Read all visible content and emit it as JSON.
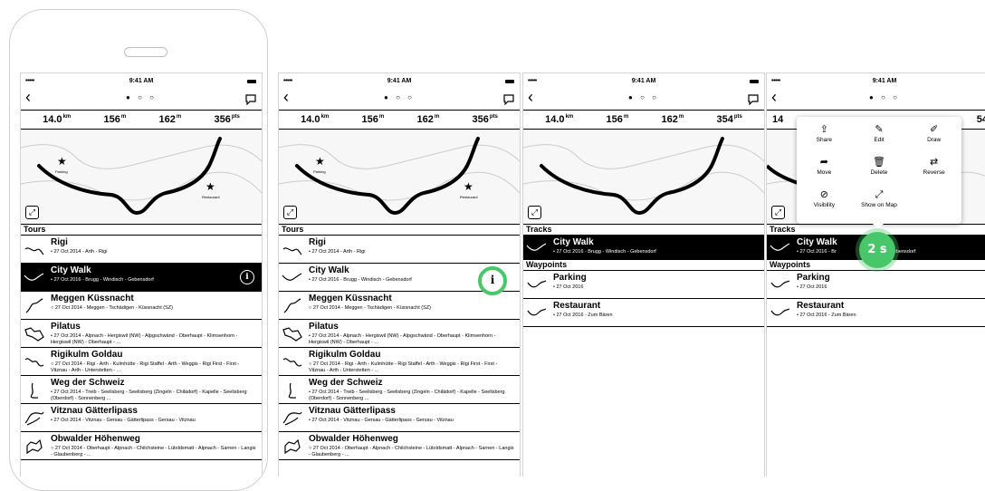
{
  "status": {
    "signal": "•••••",
    "time": "9:41 AM"
  },
  "nav": {
    "back": "‹",
    "dots": "● ○ ○"
  },
  "stats_a": [
    {
      "value": "14.0",
      "unit": "km"
    },
    {
      "value": "156",
      "unit": "m"
    },
    {
      "value": "162",
      "unit": "m"
    },
    {
      "value": "356",
      "unit": "pts"
    }
  ],
  "stats_b": [
    {
      "value": "14.0",
      "unit": "km"
    },
    {
      "value": "156",
      "unit": "m"
    },
    {
      "value": "162",
      "unit": "m"
    },
    {
      "value": "354",
      "unit": "pts"
    }
  ],
  "stats_d_last": {
    "value": "54",
    "unit": "pts"
  },
  "map": {
    "label_parking": "Parking",
    "label_restaurant": "Restaurant"
  },
  "tours": {
    "header": "Tours",
    "items": [
      {
        "name": "Rigi",
        "sub": "• 27 Oct 2014 - Arth - Rigi"
      },
      {
        "name": "City Walk",
        "sub": "• 27 Oct 2016 - Brugg - Windisch - Gebensdorf"
      },
      {
        "name": "Meggen Küssnacht",
        "sub": "○ 27 Oct 2014 - Meggen - Tschädigen - Küssnacht (SZ)"
      },
      {
        "name": "Pilatus",
        "sub": "• 27 Oct 2014 - Alpnach - Hergiswil (NW) - Alpgschwänd - Oberhaupt - Klimsenhorn - Hergiswil (NW) - Oberhaupt - ..."
      },
      {
        "name": "Rigikulm Goldau",
        "sub": "○ 27 Oct 2014 - Rigi - Arth - Kulmhütte - Rigi Staffel - Arth - Weggis - Rigi First - First - Vitznau - Arth - Unterstetten - ..."
      },
      {
        "name": "Weg der Schweiz",
        "sub": "• 27 Oct 2014 - Treib - Seelisberg - Seelisberg (Zingeln - Chilädorf) - Kapelle - Seelisberg (Oberdorf) - Sonnenberg ..."
      },
      {
        "name": "Vitznau Gätterlipass",
        "sub": "• 27 Oct 2014 - Vitznau - Gersau - Gätterlipass - Gersau - Vitznau"
      },
      {
        "name": "Obwalder Höhenweg",
        "sub": "○ 27 Oct 2014 - Oberhaupt - Alpnach - Chilchsteine - Lütoldsmatt - Alpnach - Sarnen - Langis - Glaubenberg - ..."
      }
    ]
  },
  "tracks": {
    "header": "Tracks",
    "item": {
      "name": "City Walk",
      "sub": "• 27 Oct 2016 - Brugg - Windisch - Gebensdorf"
    },
    "sub_partial_a": "• 27 Oct 2016 - Br",
    "sub_partial_b": "ch - Gebensdorf"
  },
  "waypoints": {
    "header": "Waypoints",
    "items": [
      {
        "name": "Parking",
        "sub": "• 27 Oct 2016"
      },
      {
        "name": "Restaurant",
        "sub": "• 27 Oct 2016 - Zum Bären"
      }
    ]
  },
  "popup": {
    "actions": [
      {
        "icon": "share-icon",
        "glyph": "⇪",
        "label": "Share"
      },
      {
        "icon": "edit-icon",
        "glyph": "✎",
        "label": "Edit"
      },
      {
        "icon": "draw-icon",
        "glyph": "✐",
        "label": "Draw"
      },
      {
        "icon": "move-icon",
        "glyph": "➦",
        "label": "Move"
      },
      {
        "icon": "delete-icon",
        "glyph": "🗑",
        "label": "Delete"
      },
      {
        "icon": "reverse-icon",
        "glyph": "⇄",
        "label": "Reverse"
      },
      {
        "icon": "visibility-icon",
        "glyph": "⊘",
        "label": "Visibility"
      },
      {
        "icon": "show-on-map-icon",
        "glyph": "⤢",
        "label": "Show on Map"
      }
    ]
  },
  "timer": "2 s",
  "colors": {
    "accent_green": "#48c76a",
    "selected_bg": "#000000"
  }
}
